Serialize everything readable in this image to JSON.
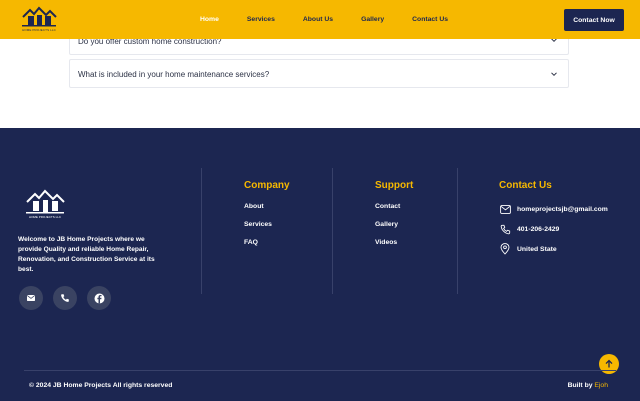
{
  "header": {
    "logo_text": "HOME PROJECTS LLC",
    "nav": [
      {
        "label": "Home",
        "active": true
      },
      {
        "label": "Services",
        "active": false
      },
      {
        "label": "About Us",
        "active": false
      },
      {
        "label": "Gallery",
        "active": false
      },
      {
        "label": "Contact Us",
        "active": false
      }
    ],
    "cta_label": "Contact Now"
  },
  "faq": {
    "items": [
      {
        "question": "Do you offer custom home construction?"
      },
      {
        "question": "What is included in your home maintenance services?"
      }
    ]
  },
  "footer": {
    "logo_text": "HOME PROJECTS LLC",
    "about": "Welcome to JB Home Projects where we provide Quality and reliable Home Repair, Renovation, and Construction Service at its best.",
    "socials": [
      {
        "icon": "mail-icon"
      },
      {
        "icon": "phone-icon"
      },
      {
        "icon": "facebook-icon"
      }
    ],
    "company": {
      "title": "Company",
      "links": [
        "About",
        "Services",
        "FAQ"
      ]
    },
    "support": {
      "title": "Support",
      "links": [
        "Contact",
        "Gallery",
        "Videos"
      ]
    },
    "contact": {
      "title": "Contact Us",
      "email": "homeprojectsjb@gmail.com",
      "phone": "401-206-2429",
      "location": "United State"
    },
    "copyright": "© 2024 JB Home Projects All rights reserved",
    "built_by_label": "Built by",
    "built_by_brand": "Ejoh"
  },
  "colors": {
    "accent": "#f6b800",
    "navy": "#1c2651"
  }
}
